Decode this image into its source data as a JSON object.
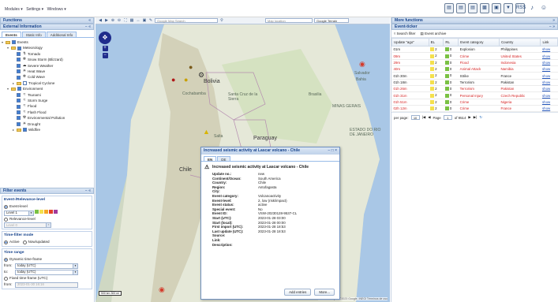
{
  "topbar": {
    "menu": [
      "Modules ▾",
      "Settings ▾",
      "Windows ▾"
    ],
    "icons": [
      "panel-icon",
      "panel-icon",
      "panel-icon",
      "chart-icon",
      "image-icon",
      "filter-icon",
      "rss-icon",
      "bell-icon",
      "user-icon"
    ],
    "rss_label": "RSS"
  },
  "left": {
    "functions_title": "Functions",
    "functions_tools": "«",
    "external_title": "External Information",
    "external_tools": "− «",
    "tabs": [
      "Events",
      "Static Info",
      "Additional Info"
    ],
    "tree": [
      {
        "level": 0,
        "label": "Events",
        "type": "folder",
        "exp": "▾",
        "checked": true
      },
      {
        "level": 1,
        "label": "Meteorology",
        "type": "folder",
        "exp": "▾",
        "checked": true
      },
      {
        "level": 2,
        "label": "Tornado",
        "icon": "↯",
        "checked": true
      },
      {
        "level": 2,
        "label": "Snow Storm (Blizzard)",
        "icon": "❄",
        "checked": true
      },
      {
        "level": 2,
        "label": "Severe Weather",
        "icon": "☁",
        "checked": true
      },
      {
        "level": 2,
        "label": "Heat Wave",
        "icon": "☀",
        "checked": true
      },
      {
        "level": 2,
        "label": "Cold Wave",
        "icon": "❄",
        "checked": true
      },
      {
        "level": 2,
        "label": "Tropical Cyclone",
        "type": "folder",
        "exp": "▸",
        "checked": false
      },
      {
        "level": 1,
        "label": "Environment",
        "type": "folder",
        "exp": "▾",
        "checked": true
      },
      {
        "level": 2,
        "label": "Tsunami",
        "icon": "≈",
        "checked": true
      },
      {
        "level": 2,
        "label": "Storm Surge",
        "icon": "≈",
        "checked": true
      },
      {
        "level": 2,
        "label": "Flood",
        "icon": "≈",
        "checked": true
      },
      {
        "level": 2,
        "label": "Flash Flood",
        "icon": "≈",
        "checked": true
      },
      {
        "level": 2,
        "label": "Environmental Pollution",
        "icon": "☢",
        "checked": true
      },
      {
        "level": 2,
        "label": "Drought",
        "icon": "☀",
        "checked": true
      },
      {
        "level": 2,
        "label": "Wildfire",
        "type": "folder",
        "exp": "▸",
        "checked": true
      }
    ],
    "filter_title": "Filter events",
    "filter_tools": "− «",
    "level_section": "Event-/Relevance-level",
    "event_level": "Event-level",
    "level_value": "Level 1",
    "relevance_level": "Relevance-level",
    "relevance_value": "Level 0",
    "level_colors": [
      "#7ac143",
      "#f4e04d",
      "#f5a623",
      "#e2402b",
      "#a23a9a"
    ],
    "time_mode_section": "Time-filter mode",
    "time_mode_active": "Active",
    "time_mode_updated": "Now/updated",
    "time_range_section": "Time range",
    "dynamic_label": "Dynamic time-frame",
    "from_label": "from:",
    "from_value": "today (UTC)",
    "to_label": "to:",
    "to_value": "today (UTC)",
    "fixed_label": "Fixed time-frame (UTC)",
    "from2_label": "from:",
    "from2_value": "2023-01-30 16:16"
  },
  "map": {
    "search_placeholder": "Google Map Search",
    "location_placeholder": "Map location",
    "layer_value": "Google Terrain",
    "labels": [
      {
        "text": "Bolivia",
        "cls": "big"
      },
      {
        "text": "Cochabamba",
        "cls": ""
      },
      {
        "text": "Santa Cruz de la Sierra",
        "cls": ""
      },
      {
        "text": "Salvador",
        "cls": ""
      },
      {
        "text": "Bahia",
        "cls": ""
      },
      {
        "text": "Paraguay",
        "cls": "big"
      },
      {
        "text": "Chile",
        "cls": "big"
      },
      {
        "text": "Salta",
        "cls": ""
      },
      {
        "text": "MINAS GERAIS",
        "cls": ""
      },
      {
        "text": "Brasilia",
        "cls": ""
      },
      {
        "text": "ESTADO DO RIO DE JANEIRO",
        "cls": ""
      }
    ],
    "scale_label": "500 km\n300 mi",
    "attribution": "Datos de mapas ©2023 Google, INEGI   Términos de uso"
  },
  "popup": {
    "title": "Increased seismic activity at Lascar volcano - Chile",
    "tools": "− □ ×",
    "tabs": [
      "EN",
      "DE"
    ],
    "heading": "Increased seismic activity at Lascar volcano - Chile",
    "fields": [
      {
        "k": "Update no.:",
        "v": "new"
      },
      {
        "k": "Continent/Ocean:",
        "v": "South America"
      },
      {
        "k": "Country:",
        "v": "Chile"
      },
      {
        "k": "Region:",
        "v": "Antofagasta"
      },
      {
        "k": "City:",
        "v": ""
      },
      {
        "k": "Event category:",
        "v": "Volcanoactivity"
      },
      {
        "k": "Event-level:",
        "v": "2, low (risk/impact)"
      },
      {
        "k": "Event status:",
        "v": "active"
      },
      {
        "k": "Special event:",
        "v": "No"
      },
      {
        "k": "Event ID:",
        "v": "VSW-20230128-9537-CL"
      },
      {
        "k": "Start (UTC):",
        "v": "2023-01-28 03:00"
      },
      {
        "k": "Start (local):",
        "v": "2023-01-28 00:00"
      },
      {
        "k": "First import (UTC):",
        "v": "2023-01-28 18:53"
      },
      {
        "k": "Last update (UTC):",
        "v": "2023-01-28 18:53"
      },
      {
        "k": "Source:",
        "v": ""
      },
      {
        "k": "Link:",
        "v": ""
      },
      {
        "k": "Description:",
        "v": ""
      }
    ],
    "btn_add": "Add entries",
    "btn_more": "More..."
  },
  "right": {
    "more_title": "More functions",
    "more_tools": "»",
    "ticker_title": "Event-ticker",
    "ticker_tools": "− »",
    "search_filter": "Search filter",
    "event_archive": "Event archive",
    "columns": [
      "Update \"ago\"",
      "EL",
      "RL",
      "Event category",
      "Country",
      "Link"
    ],
    "rows": [
      {
        "ago": "01m",
        "el": "2",
        "elc": "#f4e04d",
        "rl": "0",
        "rlc": "#7ac143",
        "cat": "Explosion",
        "country": "Philippines",
        "red": false
      },
      {
        "ago": "09m",
        "el": "2",
        "elc": "#f4e04d",
        "rl": "0",
        "rlc": "#7ac143",
        "cat": "Crime",
        "country": "United States",
        "red": true
      },
      {
        "ago": "29m",
        "el": "2",
        "elc": "#f4e04d",
        "rl": "0",
        "rlc": "#7ac143",
        "cat": "Flood",
        "country": "Indonesia",
        "red": true
      },
      {
        "ago": "40m",
        "el": "2",
        "elc": "#f4e04d",
        "rl": "0",
        "rlc": "#7ac143",
        "cat": "Animal Attack",
        "country": "Namibia",
        "red": true
      },
      {
        "ago": "01h 30m",
        "el": "2",
        "elc": "#f4e04d",
        "rl": "0",
        "rlc": "#7ac143",
        "cat": "Strike",
        "country": "France",
        "red": false
      },
      {
        "ago": "01h 18m",
        "el": "2",
        "elc": "#f4e04d",
        "rl": "0",
        "rlc": "#7ac143",
        "cat": "Terrorism",
        "country": "Pakistan",
        "red": false
      },
      {
        "ago": "01h 26m",
        "el": "2",
        "elc": "#f4e04d",
        "rl": "0",
        "rlc": "#7ac143",
        "cat": "Terrorism",
        "country": "Pakistan",
        "red": true
      },
      {
        "ago": "01h 31m",
        "el": "2",
        "elc": "#f4e04d",
        "rl": "0",
        "rlc": "#7ac143",
        "cat": "Personal Injury",
        "country": "Czech Republic",
        "red": true
      },
      {
        "ago": "01h 51m",
        "el": "2",
        "elc": "#f4e04d",
        "rl": "0",
        "rlc": "#7ac143",
        "cat": "Crime",
        "country": "Nigeria",
        "red": true
      },
      {
        "ago": "02h 12m",
        "el": "2",
        "elc": "#f4e04d",
        "rl": "0",
        "rlc": "#7ac143",
        "cat": "Crime",
        "country": "France",
        "red": true
      }
    ],
    "link_label": "show",
    "pager": {
      "per_page_label": "per page:",
      "per_page": "10",
      "page_label": "Page",
      "page": "1",
      "of_label": "of 9514"
    }
  }
}
